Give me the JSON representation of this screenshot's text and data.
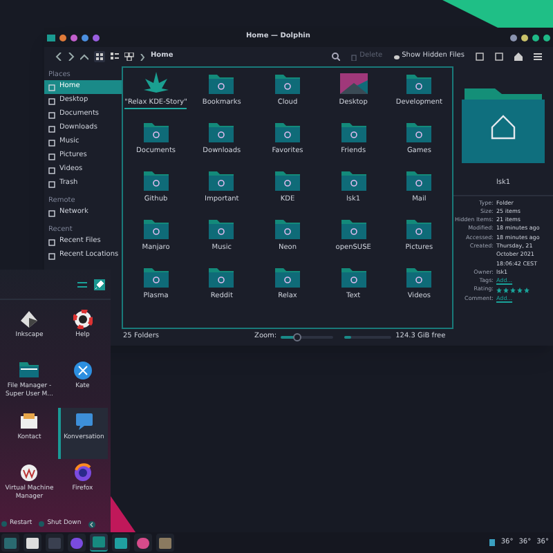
{
  "window": {
    "title": "Home — Dolphin"
  },
  "toolbar": {
    "breadcrumb": "Home",
    "actions": [
      {
        "label": "Delete",
        "disabled": true
      },
      {
        "label": "Show Hidden Files",
        "disabled": false
      }
    ]
  },
  "sidebar": {
    "sections": [
      {
        "heading": "Places",
        "items": [
          {
            "label": "Home",
            "selected": true
          },
          {
            "label": "Desktop",
            "selected": false
          },
          {
            "label": "Documents",
            "selected": false
          },
          {
            "label": "Downloads",
            "selected": false
          },
          {
            "label": "Music",
            "selected": false
          },
          {
            "label": "Pictures",
            "selected": false
          },
          {
            "label": "Videos",
            "selected": false
          },
          {
            "label": "Trash",
            "selected": false
          }
        ]
      },
      {
        "heading": "Remote",
        "items": [
          {
            "label": "Network",
            "selected": false
          }
        ]
      },
      {
        "heading": "Recent",
        "items": [
          {
            "label": "Recent Files",
            "selected": false
          },
          {
            "label": "Recent Locations",
            "selected": false
          }
        ]
      }
    ]
  },
  "files": [
    {
      "name": "\"Relax KDE-Story\"",
      "kind": "leaf",
      "selected": true
    },
    {
      "name": "Bookmarks",
      "kind": "folder",
      "selected": false
    },
    {
      "name": "Cloud",
      "kind": "folder",
      "selected": false
    },
    {
      "name": "Desktop",
      "kind": "image",
      "selected": false
    },
    {
      "name": "Development",
      "kind": "folder",
      "selected": false
    },
    {
      "name": "Documents",
      "kind": "folder",
      "selected": false
    },
    {
      "name": "Downloads",
      "kind": "folder",
      "selected": false
    },
    {
      "name": "Favorites",
      "kind": "folder",
      "selected": false
    },
    {
      "name": "Friends",
      "kind": "folder",
      "selected": false
    },
    {
      "name": "Games",
      "kind": "folder",
      "selected": false
    },
    {
      "name": "Github",
      "kind": "folder",
      "selected": false
    },
    {
      "name": "Important",
      "kind": "folder",
      "selected": false
    },
    {
      "name": "KDE",
      "kind": "folder",
      "selected": false
    },
    {
      "name": "lsk1",
      "kind": "folder",
      "selected": false
    },
    {
      "name": "Mail",
      "kind": "folder",
      "selected": false
    },
    {
      "name": "Manjaro",
      "kind": "folder",
      "selected": false
    },
    {
      "name": "Music",
      "kind": "folder",
      "selected": false
    },
    {
      "name": "Neon",
      "kind": "folder",
      "selected": false
    },
    {
      "name": "openSUSE",
      "kind": "folder",
      "selected": false
    },
    {
      "name": "Pictures",
      "kind": "folder",
      "selected": false
    },
    {
      "name": "Plasma",
      "kind": "folder",
      "selected": false
    },
    {
      "name": "Reddit",
      "kind": "folder",
      "selected": false
    },
    {
      "name": "Relax",
      "kind": "folder",
      "selected": false
    },
    {
      "name": "Text",
      "kind": "folder",
      "selected": false
    },
    {
      "name": "Videos",
      "kind": "folder",
      "selected": false
    }
  ],
  "info_panel": {
    "name": "lsk1",
    "fields": [
      {
        "label": "Type:",
        "value": "Folder",
        "kind": "text"
      },
      {
        "label": "Size:",
        "value": "25 items",
        "kind": "text"
      },
      {
        "label": "Hidden Items:",
        "value": "21 items",
        "kind": "text"
      },
      {
        "label": "Modified:",
        "value": "18 minutes ago",
        "kind": "text"
      },
      {
        "label": "Accessed:",
        "value": "18 minutes ago",
        "kind": "text"
      },
      {
        "label": "Created:",
        "value": "Thursday, 21 October 2021 18:06:42 CEST",
        "kind": "text"
      },
      {
        "label": "Owner:",
        "value": "lsk1",
        "kind": "text"
      },
      {
        "label": "Tags:",
        "value": "Add...",
        "kind": "link"
      },
      {
        "label": "Rating:",
        "stars": 5,
        "kind": "rating"
      },
      {
        "label": "Comment:",
        "value": "Add...",
        "kind": "link"
      }
    ]
  },
  "status_bar": {
    "count": "25 Folders",
    "zoom_label": "Zoom:",
    "zoom": {
      "level": 0.3
    },
    "disk": {
      "level": 0.15
    },
    "free": "124.3 GiB free"
  },
  "launcher": {
    "apps": [
      {
        "name": "Inkscape",
        "selected": false
      },
      {
        "name": "Help",
        "selected": false
      },
      {
        "name": "File Manager - Super User M...",
        "selected": false
      },
      {
        "name": "Kate",
        "selected": false
      },
      {
        "name": "Kontact",
        "selected": false
      },
      {
        "name": "Konversation",
        "selected": true
      },
      {
        "name": "Virtual Machine Manager",
        "selected": false
      },
      {
        "name": "Firefox",
        "selected": false
      }
    ],
    "power": [
      "Restart",
      "Shut Down"
    ]
  },
  "tray": {
    "temperatures": [
      "36°",
      "36°",
      "36°"
    ]
  }
}
